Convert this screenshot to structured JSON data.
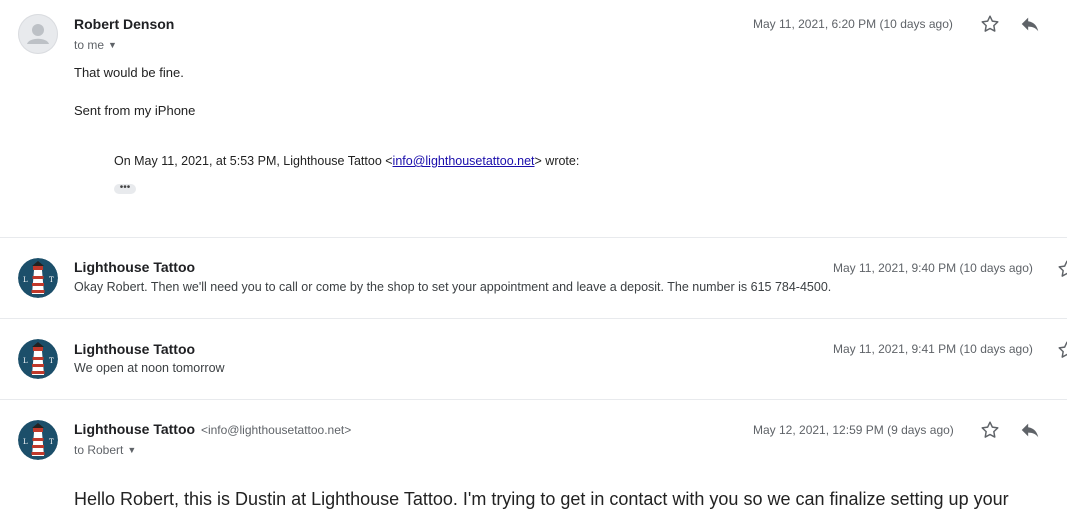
{
  "messages": [
    {
      "sender": "Robert Denson",
      "recipient": "to me",
      "date": "May 11, 2021, 6:20 PM (10 days ago)",
      "body_lines": [
        "That would be fine.",
        "Sent from my iPhone"
      ],
      "quote": {
        "prefix": "On May 11, 2021, at 5:53 PM, Lighthouse Tattoo <",
        "email": "info@lighthousetattoo.net",
        "suffix": "> wrote:"
      },
      "ellipsis": "•••"
    },
    {
      "sender": "Lighthouse Tattoo",
      "date": "May 11, 2021, 9:40 PM (10 days ago)",
      "snippet": "Okay Robert. Then we'll need you to call or come by the shop to set your appointment and leave a deposit. The number is 615 784-4500."
    },
    {
      "sender": "Lighthouse Tattoo",
      "date": "May 11, 2021, 9:41 PM (10 days ago)",
      "snippet": "We open at noon tomorrow"
    },
    {
      "sender": "Lighthouse Tattoo",
      "sender_email": "<info@lighthousetattoo.net>",
      "recipient": "to Robert",
      "date": "May 12, 2021, 12:59 PM (9 days ago)",
      "body_line": "Hello Robert, this is Dustin at Lighthouse Tattoo. I'm trying to get in contact with you so we can finalize setting up your"
    }
  ],
  "icons": {
    "star": "star-icon",
    "reply": "reply-icon",
    "dropdown": "chevron-down-icon",
    "avatar_default": "person-icon",
    "avatar_brand": "lighthouse-logo-icon"
  },
  "colors": {
    "link": "#1a0dab",
    "meta_text": "#5f6368",
    "avatar_bg": "#1c4f6a"
  }
}
